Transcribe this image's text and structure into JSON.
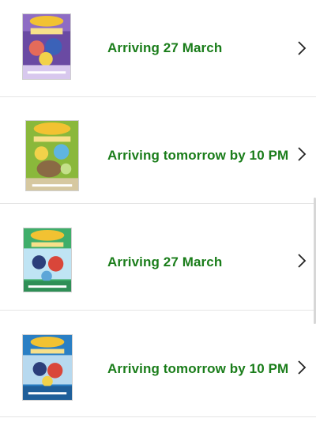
{
  "orders": [
    {
      "status": "Arriving 27 March",
      "thumbnail": {
        "icon": "dvd-cover-image",
        "colors": {
          "background": "#6a4aa3",
          "accent": "#f2c232",
          "ground": "#d8c8ee"
        }
      }
    },
    {
      "status": "Arriving tomorrow by 10 PM",
      "thumbnail": {
        "icon": "dvd-cover-image",
        "colors": {
          "background": "#8ab83b",
          "accent": "#f2c232",
          "ground": "#d6c8a0"
        }
      }
    },
    {
      "status": "Arriving 27 March",
      "thumbnail": {
        "icon": "dvd-cover-image",
        "colors": {
          "background": "#3fae6a",
          "accent": "#f2c232",
          "ground": "#bfe4f4"
        }
      }
    },
    {
      "status": "Arriving tomorrow by 10 PM",
      "thumbnail": {
        "icon": "dvd-cover-image",
        "colors": {
          "background": "#2a7fc4",
          "accent": "#f2c232",
          "ground": "#b7d9ef"
        }
      }
    }
  ],
  "style": {
    "status_color": "#1a7d1a",
    "divider_color": "#e5e5e5",
    "chevron_icon": "chevron-right-icon"
  }
}
